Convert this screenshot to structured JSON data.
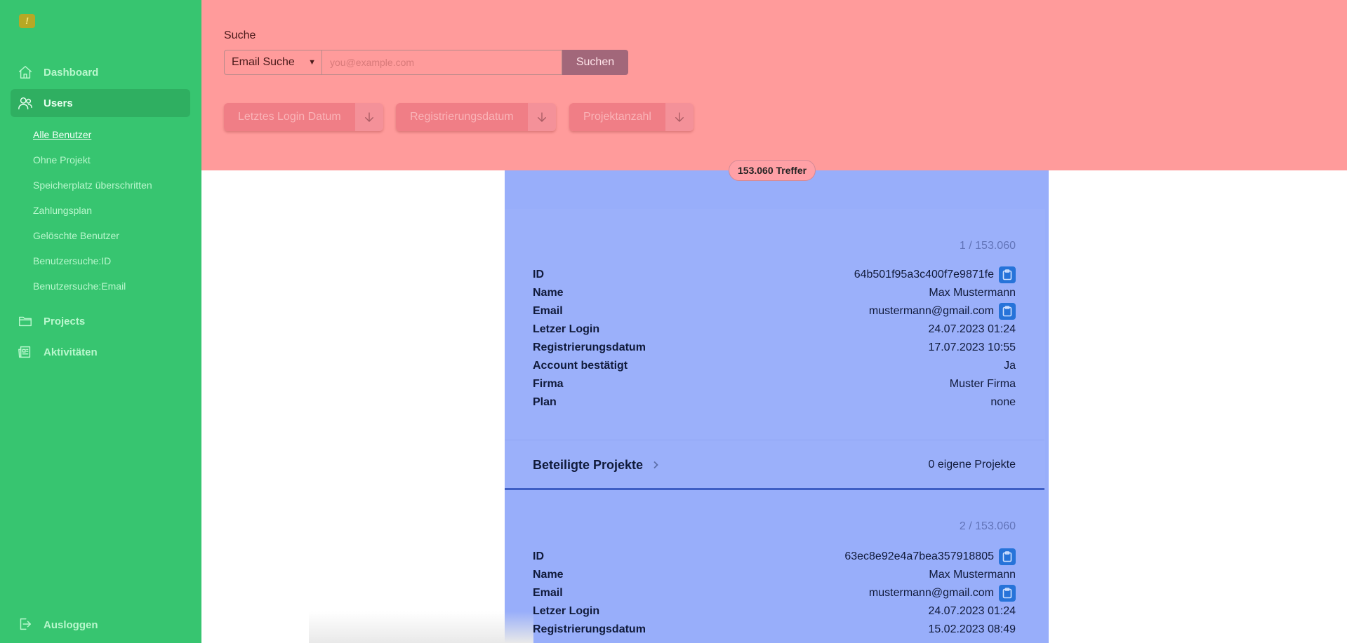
{
  "sidebar": {
    "logo_text": "!",
    "items": [
      {
        "label": "Dashboard",
        "icon": "home-icon"
      },
      {
        "label": "Users",
        "icon": "users-icon"
      },
      {
        "label": "Projects",
        "icon": "folder-icon"
      },
      {
        "label": "Aktivitäten",
        "icon": "newspaper-icon"
      }
    ],
    "sub_items": [
      {
        "label": "Alle Benutzer"
      },
      {
        "label": "Ohne Projekt"
      },
      {
        "label": "Speicherplatz überschritten"
      },
      {
        "label": "Zahlungsplan"
      },
      {
        "label": "Gelöschte Benutzer"
      },
      {
        "label": "Benutzersuche:ID"
      },
      {
        "label": "Benutzersuche:Email"
      }
    ],
    "logout_label": "Ausloggen"
  },
  "search": {
    "label": "Suche",
    "select_value": "Email Suche",
    "placeholder": "you@example.com",
    "button_label": "Suchen"
  },
  "sort": [
    {
      "label": "Letztes Login Datum"
    },
    {
      "label": "Registrierungsdatum"
    },
    {
      "label": "Projektanzahl"
    }
  ],
  "results": {
    "hits_label": "153.060 Treffer",
    "cards": [
      {
        "counter": "1 / 153.060",
        "fields": [
          {
            "key": "ID",
            "value": "64b501f95a3c400f7e9871fe"
          },
          {
            "key": "Name",
            "value": "Max Mustermann"
          },
          {
            "key": "Email",
            "value": "mustermann@gmail.com"
          },
          {
            "key": "Letzer Login",
            "value": "24.07.2023 01:24"
          },
          {
            "key": "Registrierungsdatum",
            "value": "17.07.2023 10:55"
          },
          {
            "key": "Account bestätigt",
            "value": "Ja"
          },
          {
            "key": "Firma",
            "value": "Muster Firma"
          },
          {
            "key": "Plan",
            "value": "none"
          }
        ],
        "projects_title": "Beteiligte Projekte",
        "projects_count": "0 eigene Projekte"
      },
      {
        "counter": "2 / 153.060",
        "fields": [
          {
            "key": "ID",
            "value": "63ec8e92e4a7bea357918805"
          },
          {
            "key": "Name",
            "value": "Max Mustermann"
          },
          {
            "key": "Email",
            "value": "mustermann@gmail.com"
          },
          {
            "key": "Letzer Login",
            "value": "24.07.2023 01:24"
          },
          {
            "key": "Registrierungsdatum",
            "value": "15.02.2023 08:49"
          }
        ]
      }
    ]
  }
}
